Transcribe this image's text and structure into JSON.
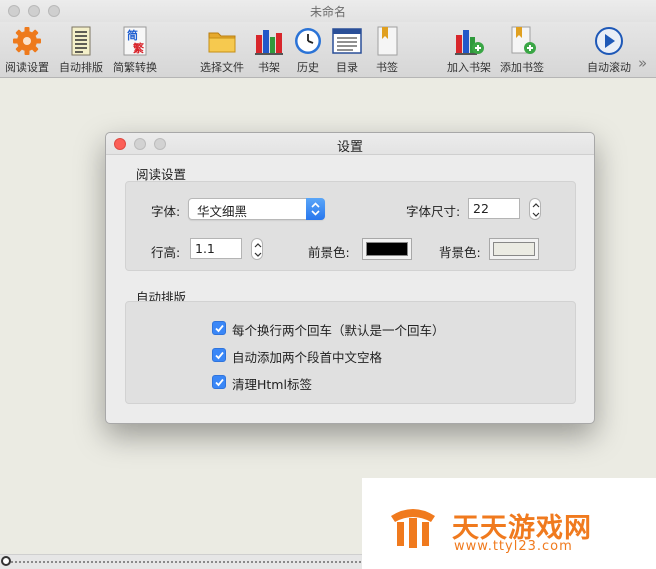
{
  "window": {
    "title": "未命名"
  },
  "toolbar": {
    "items": [
      {
        "label": "阅读设置",
        "icon": "gear-icon"
      },
      {
        "label": "自动排版",
        "icon": "text-layout-icon"
      },
      {
        "label": "简繁转换",
        "icon": "simplified-traditional-icon",
        "glyph_top": "简",
        "glyph_bottom": "繁"
      },
      {
        "label": "选择文件",
        "icon": "folder-icon"
      },
      {
        "label": "书架",
        "icon": "bookshelf-icon"
      },
      {
        "label": "历史",
        "icon": "clock-icon"
      },
      {
        "label": "目录",
        "icon": "list-icon"
      },
      {
        "label": "书签",
        "icon": "bookmark-icon"
      },
      {
        "label": "加入书架",
        "icon": "add-bookshelf-icon"
      },
      {
        "label": "添加书签",
        "icon": "add-bookmark-icon"
      },
      {
        "label": "自动滚动",
        "icon": "play-icon"
      }
    ],
    "overflow": "»"
  },
  "dialog": {
    "title": "设置",
    "reading": {
      "title": "阅读设置",
      "font_label": "字体:",
      "font_value": "华文细黑",
      "size_label": "字体尺寸:",
      "size_value": "22",
      "line_label": "行高:",
      "line_value": "1.1",
      "fg_label": "前景色:",
      "bg_label": "背景色:"
    },
    "layout": {
      "title": "自动排版",
      "options": [
        {
          "label": "每个换行两个回车（默认是一个回车）",
          "checked": true
        },
        {
          "label": "自动添加两个段首中文空格",
          "checked": true
        },
        {
          "label": "清理Html标签",
          "checked": true
        }
      ]
    }
  },
  "colors": {
    "foreground": "#000000",
    "background": "#ebebe3",
    "accent": "#3a87f7"
  },
  "watermark": {
    "name": "天天游戏网",
    "url": "www.ttyl23.com"
  }
}
